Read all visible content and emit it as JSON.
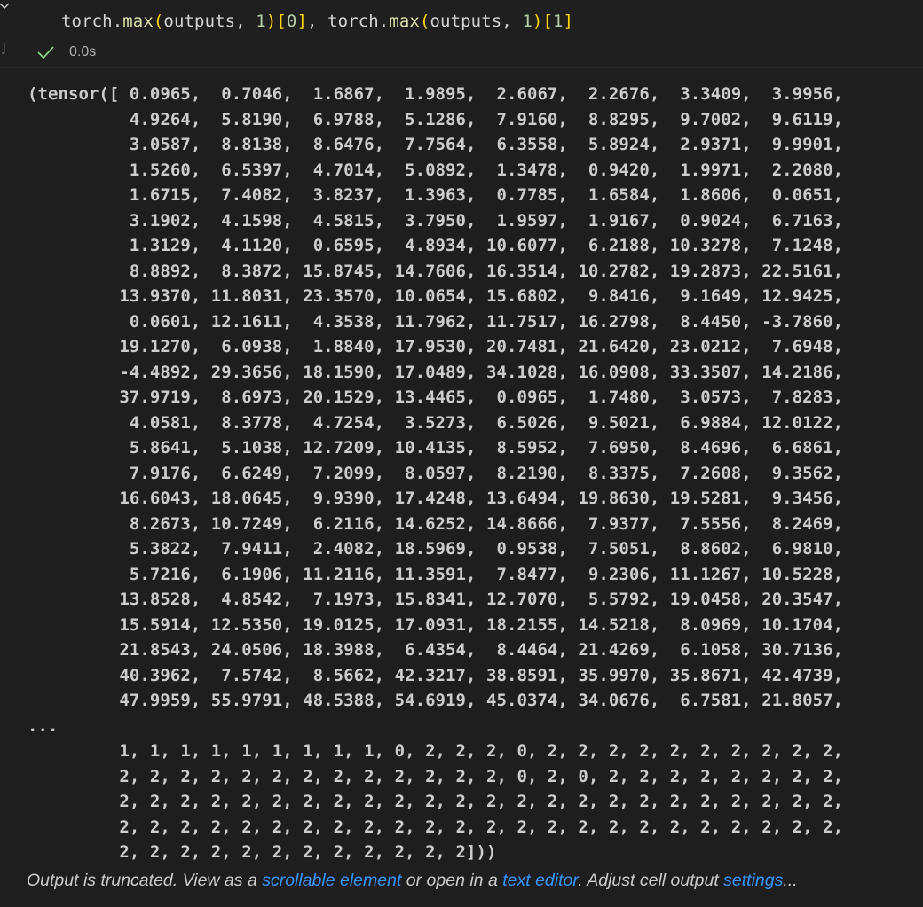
{
  "cell": {
    "code_tokens": [
      {
        "t": "torch",
        "c": "tok-id"
      },
      {
        "t": ".",
        "c": "tok-id"
      },
      {
        "t": "max",
        "c": "tok-fn"
      },
      {
        "t": "(",
        "c": "tok-p1"
      },
      {
        "t": "outputs, ",
        "c": "tok-id"
      },
      {
        "t": "1",
        "c": "tok-num"
      },
      {
        "t": ")",
        "c": "tok-p1"
      },
      {
        "t": "[",
        "c": "tok-p1"
      },
      {
        "t": "0",
        "c": "tok-num"
      },
      {
        "t": "]",
        "c": "tok-p1"
      },
      {
        "t": ", torch.",
        "c": "tok-id"
      },
      {
        "t": "max",
        "c": "tok-fn"
      },
      {
        "t": "(",
        "c": "tok-p1"
      },
      {
        "t": "outputs, ",
        "c": "tok-id"
      },
      {
        "t": "1",
        "c": "tok-num"
      },
      {
        "t": ")",
        "c": "tok-p1"
      },
      {
        "t": "[",
        "c": "tok-p1"
      },
      {
        "t": "1",
        "c": "tok-num"
      },
      {
        "t": "]",
        "c": "tok-p1"
      }
    ],
    "exec_bracket": "]",
    "duration": "0.0s",
    "status_color": "#89d185"
  },
  "output_lines": [
    "(tensor([ 0.0965,  0.7046,  1.6867,  1.9895,  2.6067,  2.2676,  3.3409,  3.9956,",
    "          4.9264,  5.8190,  6.9788,  5.1286,  7.9160,  8.8295,  9.7002,  9.6119,",
    "          3.0587,  8.8138,  8.6476,  7.7564,  6.3558,  5.8924,  2.9371,  9.9901,",
    "          1.5260,  6.5397,  4.7014,  5.0892,  1.3478,  0.9420,  1.9971,  2.2080,",
    "          1.6715,  7.4082,  3.8237,  1.3963,  0.7785,  1.6584,  1.8606,  0.0651,",
    "          3.1902,  4.1598,  4.5815,  3.7950,  1.9597,  1.9167,  0.9024,  6.7163,",
    "          1.3129,  4.1120,  0.6595,  4.8934, 10.6077,  6.2188, 10.3278,  7.1248,",
    "          8.8892,  8.3872, 15.8745, 14.7606, 16.3514, 10.2782, 19.2873, 22.5161,",
    "         13.9370, 11.8031, 23.3570, 10.0654, 15.6802,  9.8416,  9.1649, 12.9425,",
    "          0.0601, 12.1611,  4.3538, 11.7962, 11.7517, 16.2798,  8.4450, -3.7860,",
    "         19.1270,  6.0938,  1.8840, 17.9530, 20.7481, 21.6420, 23.0212,  7.6948,",
    "         -4.4892, 29.3656, 18.1590, 17.0489, 34.1028, 16.0908, 33.3507, 14.2186,",
    "         37.9719,  8.6973, 20.1529, 13.4465,  0.0965,  1.7480,  3.0573,  7.8283,",
    "          4.0581,  8.3778,  4.7254,  3.5273,  6.5026,  9.5021,  6.9884, 12.0122,",
    "          5.8641,  5.1038, 12.7209, 10.4135,  8.5952,  7.6950,  8.4696,  6.6861,",
    "          7.9176,  6.6249,  7.2099,  8.0597,  8.2190,  8.3375,  7.2608,  9.3562,",
    "         16.6043, 18.0645,  9.9390, 17.4248, 13.6494, 19.8630, 19.5281,  9.3456,",
    "          8.2673, 10.7249,  6.2116, 14.6252, 14.8666,  7.9377,  7.5556,  8.2469,",
    "          5.3822,  7.9411,  2.4082, 18.5969,  0.9538,  7.5051,  8.8602,  6.9810,",
    "          5.7216,  6.1906, 11.2116, 11.3591,  7.8477,  9.2306, 11.1267, 10.5228,",
    "         13.8528,  4.8542,  7.1973, 15.8341, 12.7070,  5.5792, 19.0458, 20.3547,",
    "         15.5914, 12.5350, 19.0125, 17.0931, 18.2155, 14.5218,  8.0969, 10.1704,",
    "         21.8543, 24.0506, 18.3988,  6.4354,  8.4464, 21.4269,  6.1058, 30.7136,",
    "         40.3962,  7.5742,  8.5662, 42.3217, 38.8591, 35.9970, 35.8671, 42.4739,",
    "         47.9959, 55.9791, 48.5388, 54.6919, 45.0374, 34.0676,  6.7581, 21.8057,",
    "...",
    "         1, 1, 1, 1, 1, 1, 1, 1, 1, 0, 2, 2, 2, 0, 2, 2, 2, 2, 2, 2, 2, 2, 2, 2,",
    "         2, 2, 2, 2, 2, 2, 2, 2, 2, 2, 2, 2, 2, 0, 2, 0, 2, 2, 2, 2, 2, 2, 2, 2,",
    "         2, 2, 2, 2, 2, 2, 2, 2, 2, 2, 2, 2, 2, 2, 2, 2, 2, 2, 2, 2, 2, 2, 2, 2,",
    "         2, 2, 2, 2, 2, 2, 2, 2, 2, 2, 2, 2, 2, 2, 2, 2, 2, 2, 2, 2, 2, 2, 2, 2,",
    "         2, 2, 2, 2, 2, 2, 2, 2, 2, 2, 2, 2]))"
  ],
  "truncation": {
    "text_1": "Output is truncated. View as a ",
    "link_scrollable": "scrollable element",
    "text_2": " or open in a ",
    "link_editor": "text editor",
    "text_3": ". Adjust cell output ",
    "link_settings": "settings",
    "text_4": "...",
    "link_color": "#3794ff"
  },
  "icons": {
    "collapse": "chevron-down-icon",
    "status": "check-icon"
  }
}
